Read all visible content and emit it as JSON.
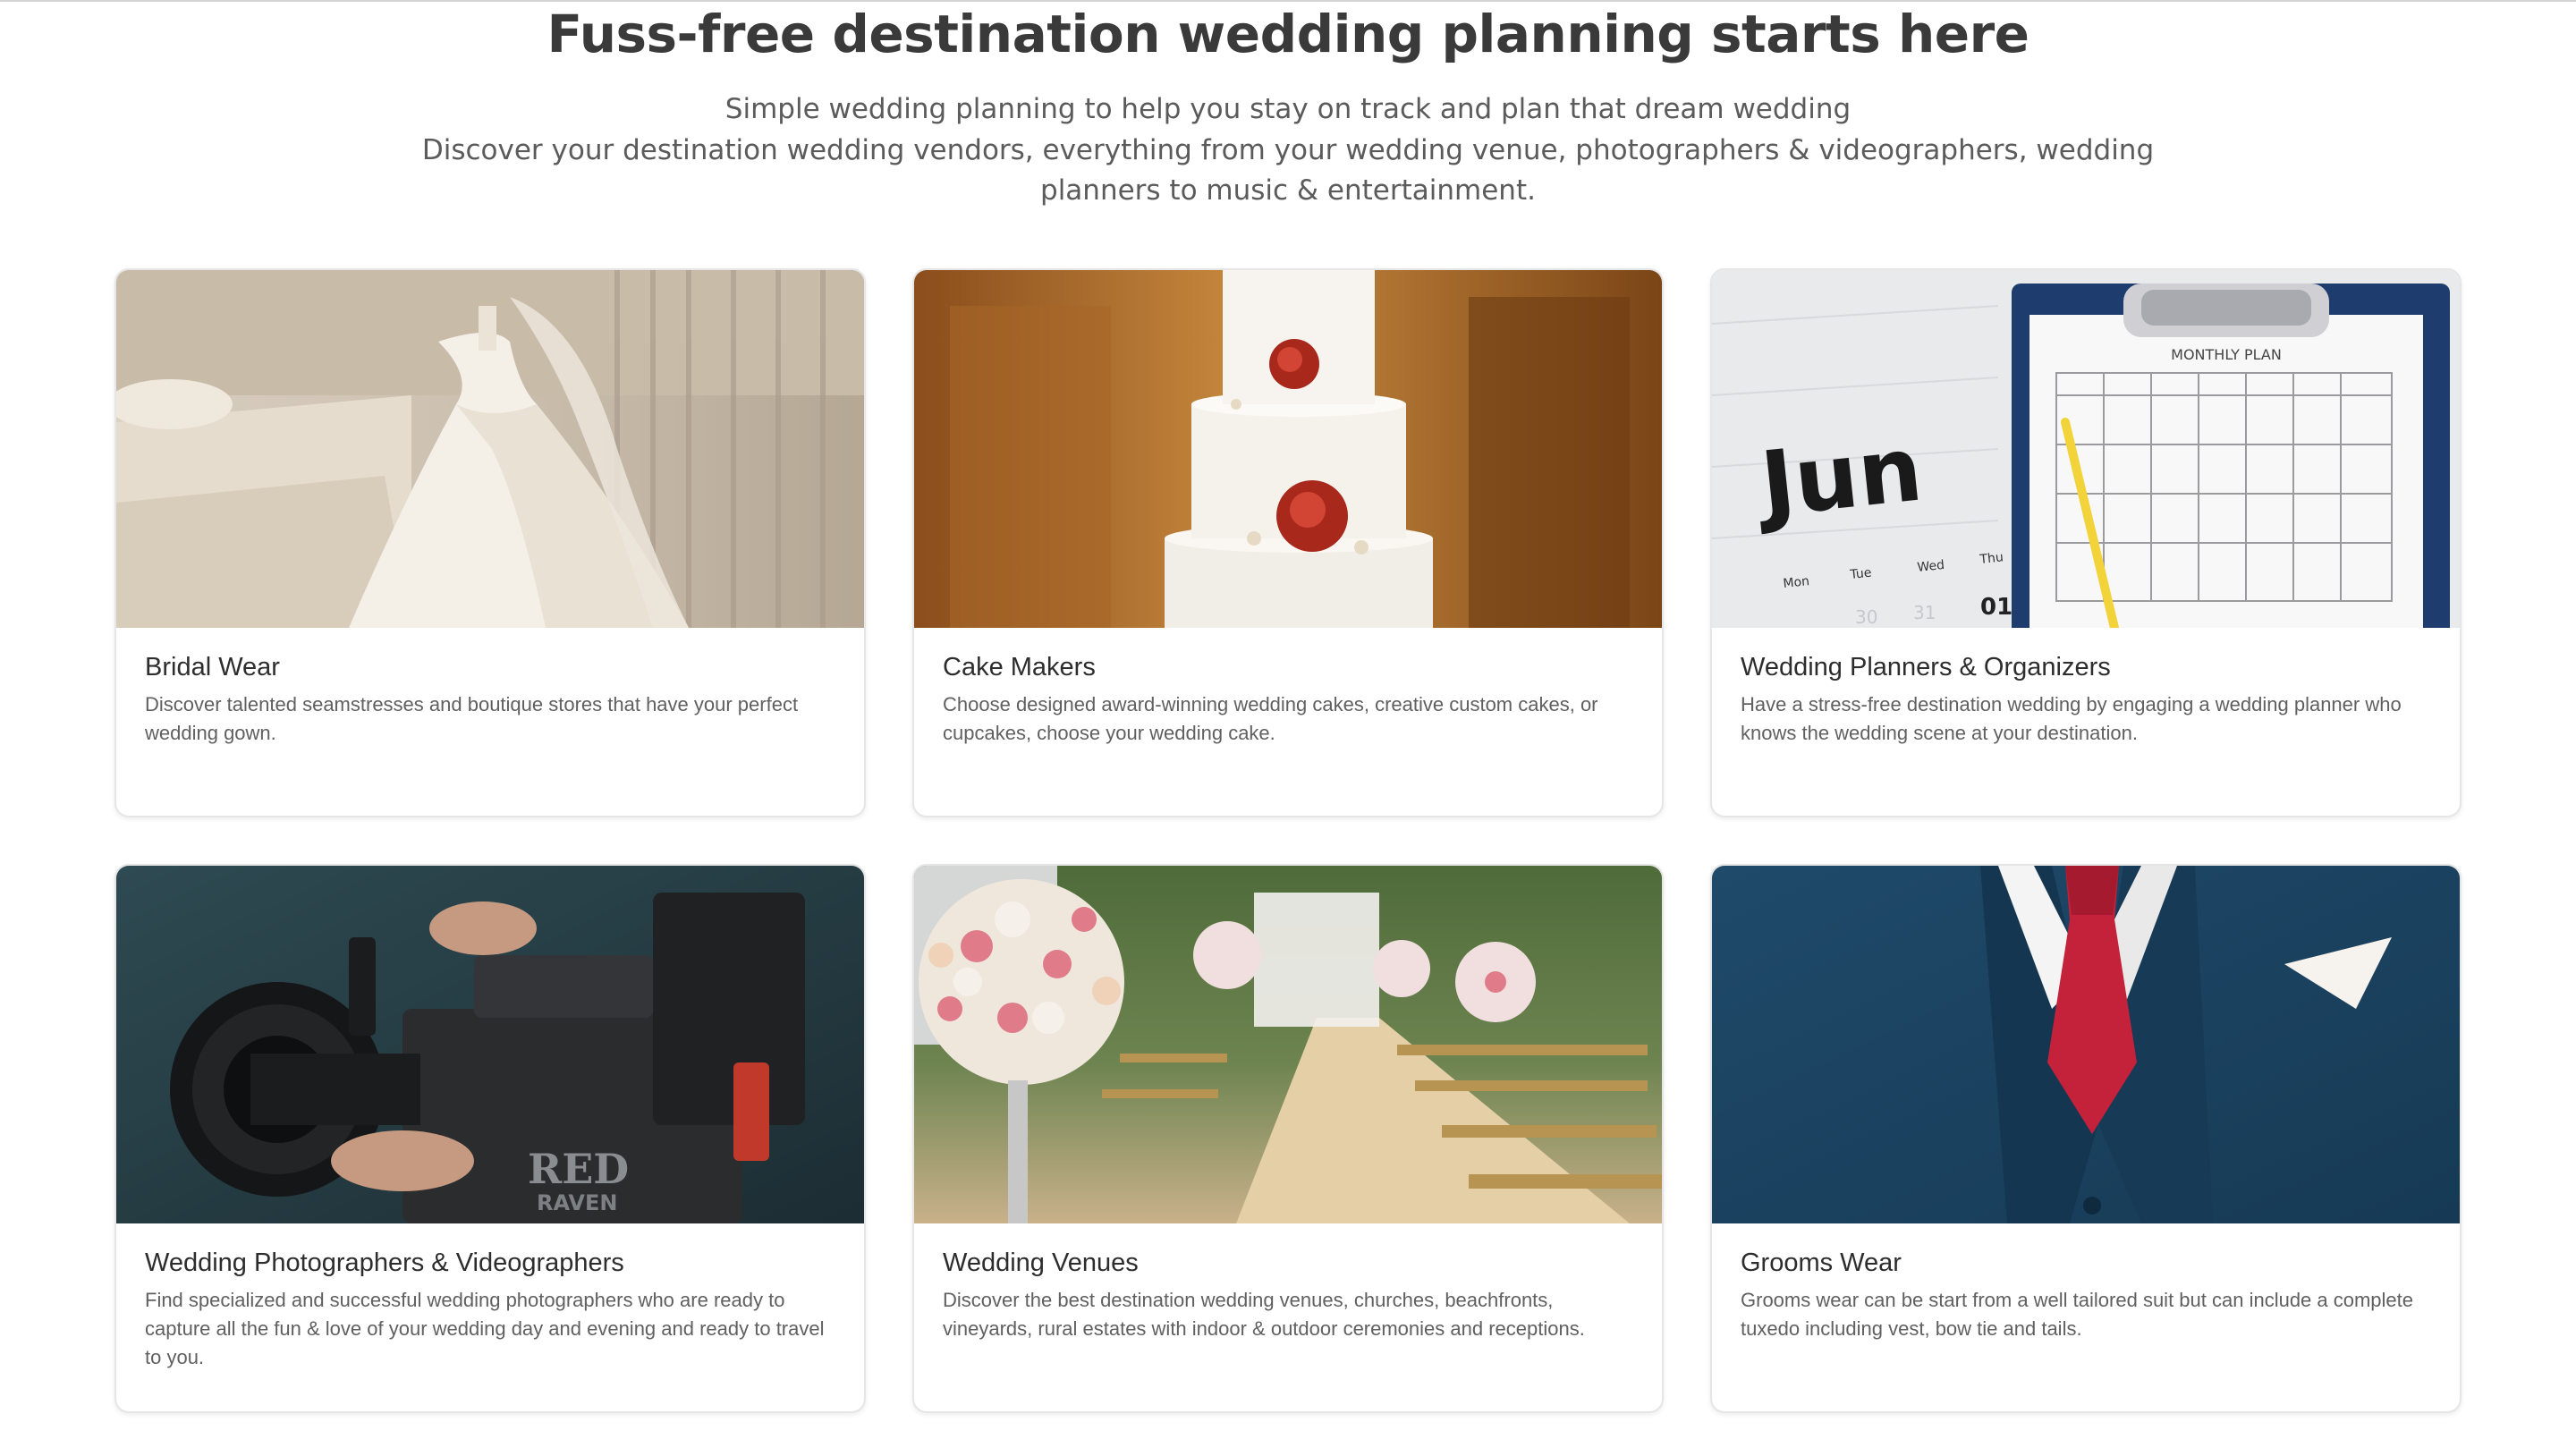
{
  "hero": {
    "title": "Fuss-free destination wedding planning starts here",
    "subtitle": "Simple wedding planning to help you stay on track and plan that dream wedding",
    "description": "Discover your destination wedding vendors, everything from your wedding venue, photographers & videographers, wedding planners to music & entertainment."
  },
  "cards": [
    {
      "title": "Bridal Wear",
      "text": "Discover talented seamstresses and boutique stores that have your perfect wedding gown.",
      "image": "wedding-dress-photo"
    },
    {
      "title": "Cake Makers",
      "text": "Choose designed award-winning wedding cakes, creative custom cakes, or cupcakes, choose your wedding cake.",
      "image": "wedding-cake-photo"
    },
    {
      "title": "Wedding Planners & Organizers",
      "text": "Have a stress-free destination wedding by engaging a wedding planner who knows the wedding scene at your destination.",
      "image": "calendar-planner-photo",
      "image_text": {
        "month": "Jun",
        "plan_header": "MONTHLY PLAN",
        "days": [
          "Mon",
          "Tue",
          "Wed",
          "Thu"
        ],
        "dates": [
          "30",
          "31",
          "01"
        ]
      }
    },
    {
      "title": "Wedding Photographers & Videographers",
      "text": "Find specialized and successful wedding photographers who are ready to capture all the fun & love of your wedding day and evening and ready to travel to you.",
      "image": "video-camera-photo",
      "image_text": {
        "brand": "RED",
        "model": "RAVEN"
      }
    },
    {
      "title": "Wedding Venues",
      "text": "Discover the best destination wedding venues, churches, beachfronts, vineyards, rural estates with indoor & outdoor ceremonies and receptions.",
      "image": "wedding-venue-aisle-photo"
    },
    {
      "title": "Grooms Wear",
      "text": "Grooms wear can be start from a well tailored suit but can include a complete tuxedo including vest, bow tie and tails.",
      "image": "groom-suit-photo"
    }
  ]
}
